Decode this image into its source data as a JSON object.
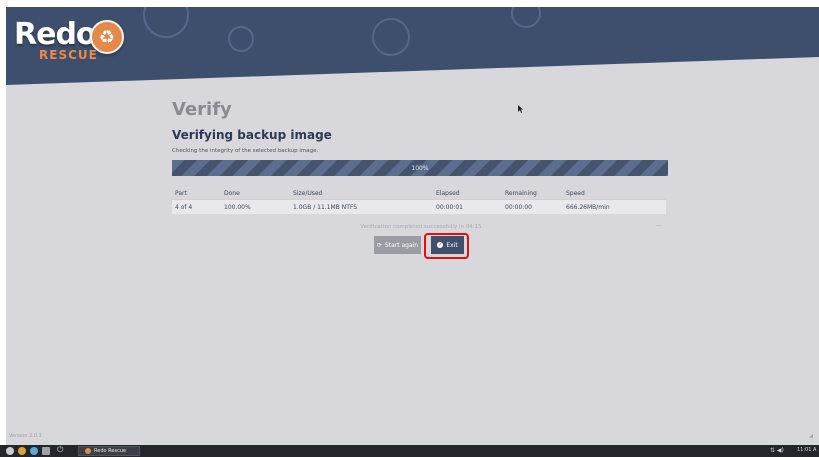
{
  "app": {
    "logo_text": "Redo",
    "logo_sub": "RESCUE",
    "version": "Version 2.0.1"
  },
  "colors": {
    "header": "#3e4f6d",
    "accent": "#e38a4a",
    "progress": "#4b5b78",
    "highlight": "#e11010"
  },
  "page": {
    "title": "Verify",
    "subtitle": "Verifying backup image",
    "description": "Checking the integrity of the selected backup image."
  },
  "progress": {
    "label": "100%",
    "value": 1.0
  },
  "table": {
    "headers": [
      "Part",
      "Done",
      "Size/Used",
      "Elapsed",
      "Remaining",
      "Speed"
    ],
    "rows": [
      [
        "4 of 4",
        "100.00%",
        "1.0GB / 11.1MB NTFS",
        "00:00:01",
        "00:00:00",
        "666.26MB/min"
      ]
    ]
  },
  "status_text": "Verification completed successfully in 04:15",
  "buttons": {
    "start_again": "Start again",
    "exit": "Exit"
  },
  "taskbar": {
    "app_label": "Redo Rescue",
    "clock": "11:01 A"
  },
  "icons": [
    "redo-logo-icon",
    "refresh-icon",
    "check-circle-icon",
    "power-icon",
    "network-icon",
    "volume-icon"
  ]
}
